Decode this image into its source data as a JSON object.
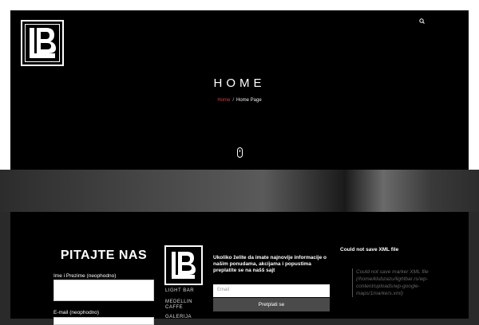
{
  "hero": {
    "title": "HOME",
    "breadcrumb": {
      "home": "Home",
      "separator": "/",
      "current": "Home Page"
    }
  },
  "contact": {
    "title": "PITAJTE NAS",
    "name_label": "Ime i Prezime (neophodno)",
    "email_label": "E-mail (neophodno)"
  },
  "footer_brand": {
    "lines": [
      "LIGHT BAR",
      "MEDELLIN",
      "CAFFE",
      "GALERIJA"
    ]
  },
  "newsletter": {
    "text": "Ukoliko želite da imate najnovije informacije o našim ponudama, akcijama i popustima preplatite se na našš sajt",
    "email_placeholder": "Email",
    "button_label": "Pretplati se"
  },
  "map_error": {
    "title": "Could not save XML file",
    "body": "Could not save marker XML file (/home/klubzazu/lightbar.rs/wp-content/uploads/wp-google-maps/1markers.xml)"
  },
  "colors": {
    "accent": "#d33d3d",
    "background": "#000000"
  }
}
